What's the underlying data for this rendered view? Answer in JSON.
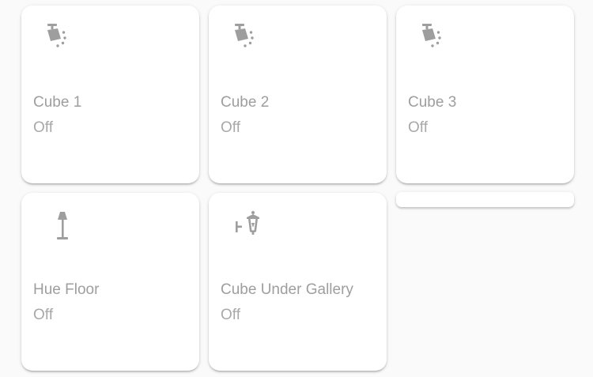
{
  "tiles": [
    {
      "name": "Cube 1",
      "state": "Off",
      "icon": "spotlight-icon"
    },
    {
      "name": "Cube 2",
      "state": "Off",
      "icon": "spotlight-icon"
    },
    {
      "name": "Cube 3",
      "state": "Off",
      "icon": "spotlight-icon"
    },
    {
      "name": "Hue Floor",
      "state": "Off",
      "icon": "floor-lamp-icon"
    },
    {
      "name": "Cube Under Gallery",
      "state": "Off",
      "icon": "wall-lantern-icon"
    }
  ],
  "colors": {
    "background": "#fafafa",
    "card": "#ffffff",
    "icon": "#9e9e9e",
    "text": "#9e9e9e"
  }
}
